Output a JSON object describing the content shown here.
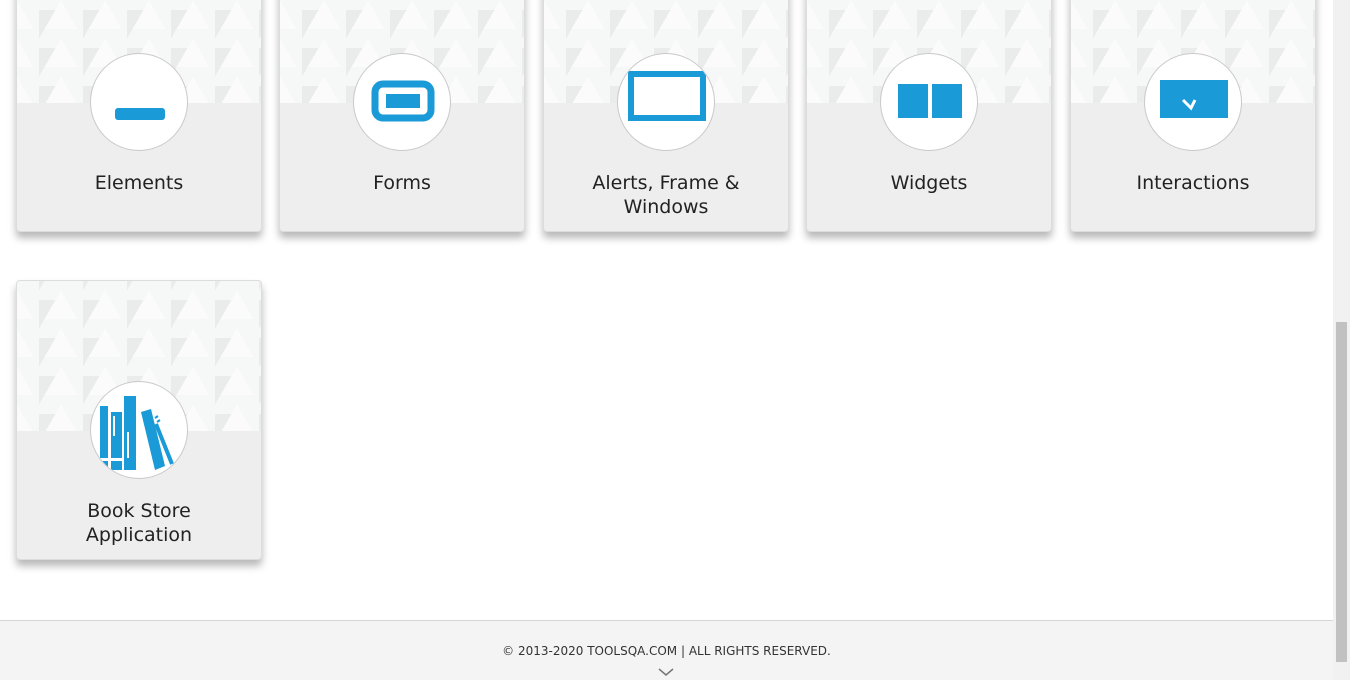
{
  "categories": [
    {
      "label": "Elements",
      "icon": "elements-icon"
    },
    {
      "label": "Forms",
      "icon": "forms-icon"
    },
    {
      "label": "Alerts, Frame & Windows",
      "icon": "alerts-frame-windows-icon"
    },
    {
      "label": "Widgets",
      "icon": "widgets-icon"
    },
    {
      "label": "Interactions",
      "icon": "interactions-icon"
    },
    {
      "label": "Book Store Application",
      "icon": "book-store-icon"
    }
  ],
  "footer": {
    "copyright": "© 2013-2020 TOOLSQA.COM | ALL RIGHTS RESERVED."
  },
  "colors": {
    "accent": "#1a9ad6",
    "card_bg": "#eeeeee"
  }
}
